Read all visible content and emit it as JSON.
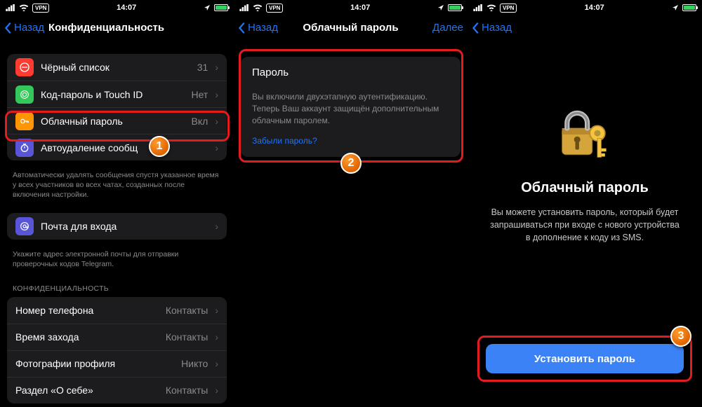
{
  "status": {
    "time": "14:07",
    "vpn": "VPN"
  },
  "panel1": {
    "back": "Назад",
    "title": "Конфиденциальность",
    "rows1": [
      {
        "icon": "stop",
        "color": "#fe3b30",
        "label": "Чёрный список",
        "value": "31"
      },
      {
        "icon": "touch",
        "color": "#34c759",
        "label": "Код-пароль и Touch ID",
        "value": "Нет"
      },
      {
        "icon": "key",
        "color": "#ff9500",
        "label": "Облачный пароль",
        "value": "Вкл"
      },
      {
        "icon": "timer",
        "color": "#5856d6",
        "label": "Автоудаление сообщ",
        "value": ""
      }
    ],
    "footer1": "Автоматически удалять сообщения спустя указанное время у всех участников во всех чатах, созданных после включения настройки.",
    "rows2": [
      {
        "icon": "at",
        "color": "#5856d6",
        "label": "Почта для входа",
        "value": ""
      }
    ],
    "footer2": "Укажите адрес электронной почты для отправки проверочных кодов Telegram.",
    "header3": "КОНФИДЕНЦИАЛЬНОСТЬ",
    "rows3": [
      {
        "label": "Номер телефона",
        "value": "Контакты"
      },
      {
        "label": "Время захода",
        "value": "Контакты"
      },
      {
        "label": "Фотографии профиля",
        "value": "Никто"
      },
      {
        "label": "Раздел «О себе»",
        "value": "Контакты"
      }
    ]
  },
  "panel2": {
    "back": "Назад",
    "title": "Облачный пароль",
    "next": "Далее",
    "card": {
      "title": "Пароль",
      "text": "Вы включили двухэтапную аутентификацию. Теперь Ваш аккаунт защищён дополнительным облачным паролем.",
      "link": "Забыли пароль?"
    }
  },
  "panel3": {
    "back": "Назад",
    "title": "Облачный пароль",
    "text": "Вы можете установить пароль, который будет запрашиваться при входе с нового устройства в дополнение к коду из SMS.",
    "button": "Установить пароль"
  },
  "markers": {
    "m1": "1",
    "m2": "2",
    "m3": "3"
  }
}
